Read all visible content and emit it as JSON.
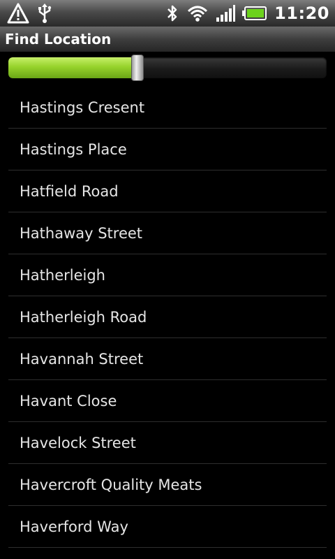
{
  "status_bar": {
    "time": "11:20",
    "icons": [
      "alert-icon",
      "usb-icon",
      "bluetooth-icon",
      "wifi-icon",
      "signal-icon",
      "battery-icon"
    ]
  },
  "title_bar": {
    "title": "Find Location"
  },
  "slider": {
    "value_fraction": 0.405,
    "fill_color": "#8cc63f"
  },
  "locations": [
    "Hastings Cresent",
    "Hastings Place",
    "Hatfield Road",
    "Hathaway Street",
    "Hatherleigh",
    "Hatherleigh Road",
    "Havannah Street",
    "Havant Close",
    "Havelock Street",
    "Havercroft Quality Meats",
    "Haverford Way"
  ]
}
